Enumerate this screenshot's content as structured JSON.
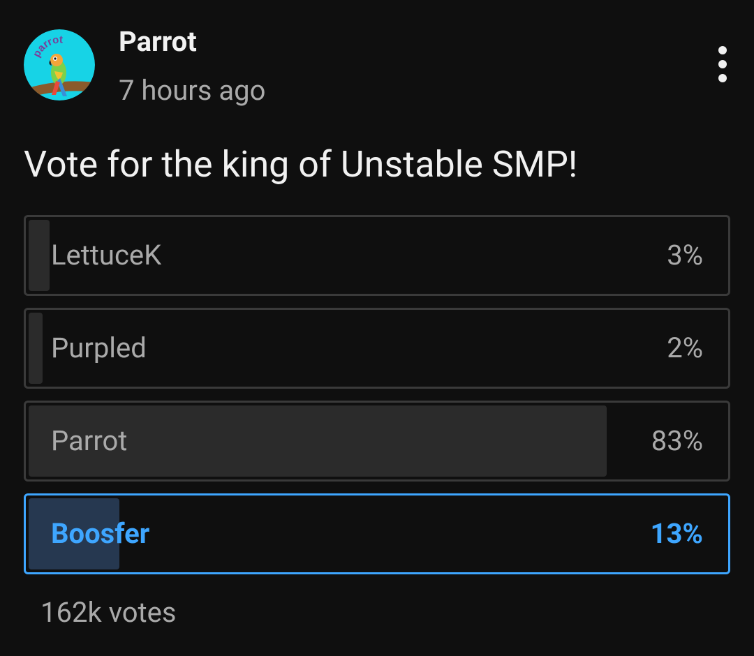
{
  "post": {
    "author": "Parrot",
    "timestamp": "7 hours ago",
    "avatar_text": "parrot",
    "question": "Vote for the king of Unstable SMP!",
    "total_votes": "162k votes"
  },
  "poll": {
    "options": [
      {
        "label": "LettuceK",
        "percent_text": "3%",
        "percent": 3,
        "selected": false
      },
      {
        "label": "Purpled",
        "percent_text": "2%",
        "percent": 2,
        "selected": false
      },
      {
        "label": "Parrot",
        "percent_text": "83%",
        "percent": 83,
        "selected": false
      },
      {
        "label": "Boosfer",
        "percent_text": "13%",
        "percent": 13,
        "selected": true
      }
    ]
  },
  "colors": {
    "background": "#0f0f0f",
    "accent": "#3ea6ff",
    "text_primary": "#f1f1f1",
    "text_secondary": "#aaaaaa"
  },
  "icons": {
    "menu": "more-vertical-icon"
  }
}
